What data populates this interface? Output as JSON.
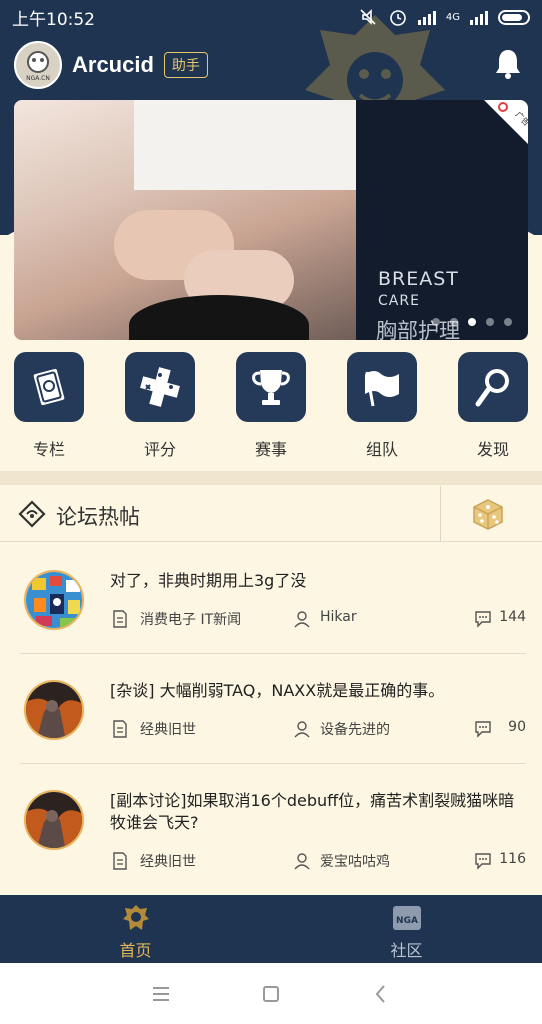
{
  "status": {
    "time": "上午10:52",
    "net": "4G"
  },
  "user": {
    "name": "Arcucid",
    "badge": "助手",
    "avatar_text": "NGA.CN"
  },
  "banner": {
    "en_line1": "BREAST",
    "en_line2": "CARE",
    "cn": "胸部护理",
    "ad_label": "广告",
    "dots": 5,
    "active_dot": 3
  },
  "categories": [
    {
      "label": "专栏",
      "icon": "card-icon"
    },
    {
      "label": "评分",
      "icon": "gamepad-icon"
    },
    {
      "label": "赛事",
      "icon": "trophy-icon"
    },
    {
      "label": "组队",
      "icon": "flag-icon"
    },
    {
      "label": "发现",
      "icon": "magnifier-icon"
    }
  ],
  "section": {
    "title": "论坛热帖"
  },
  "posts": [
    {
      "title": "对了，非典时期用上3g了没",
      "forum": "消费电子 IT新闻",
      "author": "Hikar",
      "replies": "144"
    },
    {
      "title": "[杂谈] 大幅削弱TAQ，NAXX就是最正确的事。",
      "forum": "经典旧世",
      "author": "设备先进的",
      "replies": "90"
    },
    {
      "title": "[副本讨论]如果取消16个debuff位，痛苦术割裂贼猫咪暗牧谁会飞天?",
      "forum": "经典旧世",
      "author": "爱宝咕咕鸡",
      "replies": "116"
    }
  ],
  "bottom_nav": {
    "home": "首页",
    "community": "社区",
    "community_icon_text": "NGA"
  },
  "colors": {
    "navy": "#1f3450",
    "gold": "#e3b65a",
    "cream": "#fdf6e3"
  }
}
